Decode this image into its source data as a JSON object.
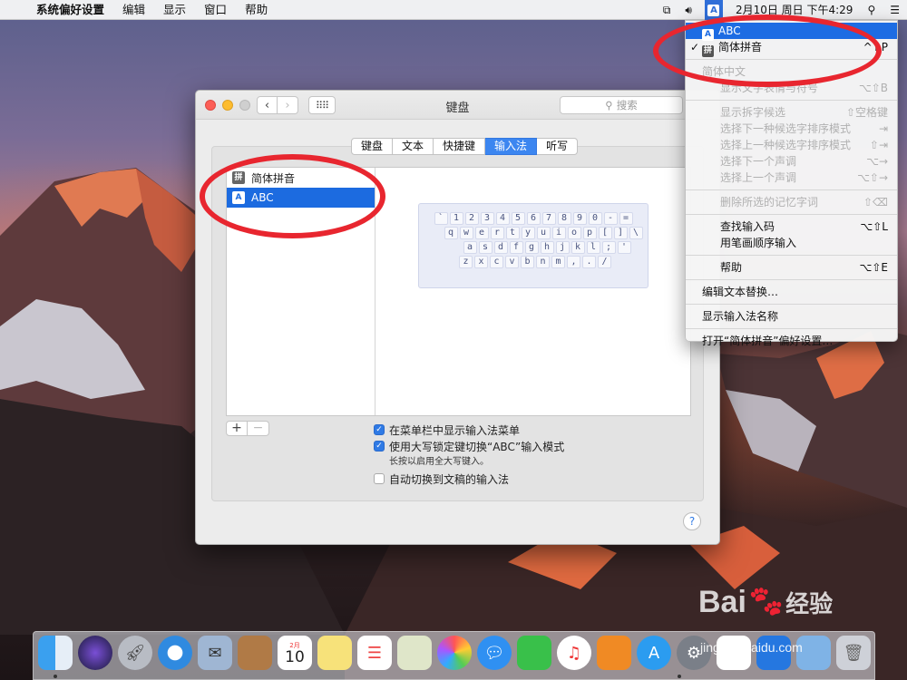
{
  "menubar": {
    "app_name": "系统偏好设置",
    "menus": [
      "编辑",
      "显示",
      "窗口",
      "帮助"
    ],
    "clock": "2月10日 周日 下午4:29",
    "ime_icon": "A"
  },
  "window": {
    "title": "键盘",
    "search_placeholder": "搜索",
    "tabs": [
      "键盘",
      "文本",
      "快捷键",
      "输入法",
      "听写"
    ],
    "active_tab": "输入法",
    "input_sources": [
      {
        "icon": "拼",
        "label": "简体拼音",
        "selected": false
      },
      {
        "icon": "A",
        "label": "ABC",
        "selected": true
      }
    ],
    "keyboard_rows": [
      [
        "`",
        "1",
        "2",
        "3",
        "4",
        "5",
        "6",
        "7",
        "8",
        "9",
        "0",
        "-",
        "="
      ],
      [
        "q",
        "w",
        "e",
        "r",
        "t",
        "y",
        "u",
        "i",
        "o",
        "p",
        "[",
        "]",
        "\\"
      ],
      [
        "a",
        "s",
        "d",
        "f",
        "g",
        "h",
        "j",
        "k",
        "l",
        ";",
        "'"
      ],
      [
        "z",
        "x",
        "c",
        "v",
        "b",
        "n",
        "m",
        ",",
        ".",
        "/"
      ]
    ],
    "add_label": "+",
    "remove_label": "−",
    "options": {
      "show_menu": "在菜单栏中显示输入法菜单",
      "capslock_switch": "使用大写锁定键切换“ABC”输入模式",
      "capslock_note": "长按以启用全大写键入。",
      "auto_switch": "自动切换到文稿的输入法"
    },
    "help_label": "?"
  },
  "dropdown": {
    "abc": "ABC",
    "pinyin": "简体拼音",
    "pinyin_shortcut": "^⇧P",
    "section_header": "简体中文",
    "section_item": "显示文字表情与符号",
    "section_item_shortcut": "⌥⇧B",
    "cand1": "显示拆字候选",
    "cand1_sc": "⇧空格键",
    "cand2": "选择下一种候选字排序模式",
    "cand2_sc": "⇥",
    "cand3": "选择上一种候选字排序模式",
    "cand3_sc": "⇧⇥",
    "cand4": "选择下一个声调",
    "cand4_sc": "⌥→",
    "cand5": "选择上一个声调",
    "cand5_sc": "⌥⇧→",
    "delete_mem": "删除所选的记忆字词",
    "delete_mem_sc": "⇧⌫",
    "lookup": "查找输入码",
    "lookup_sc": "⌥⇧L",
    "stroke": "用笔画顺序输入",
    "help": "帮助",
    "help_sc": "⌥⇧E",
    "edit_replace": "编辑文本替换…",
    "show_name": "显示输入法名称",
    "open_prefs": "打开“简体拼音”偏好设置…"
  },
  "dock": {
    "calendar_month": "2月",
    "calendar_day": "10"
  },
  "watermark": {
    "brand": "Bai",
    "brand2": "经验",
    "url": "jingyan.baidu.com"
  }
}
